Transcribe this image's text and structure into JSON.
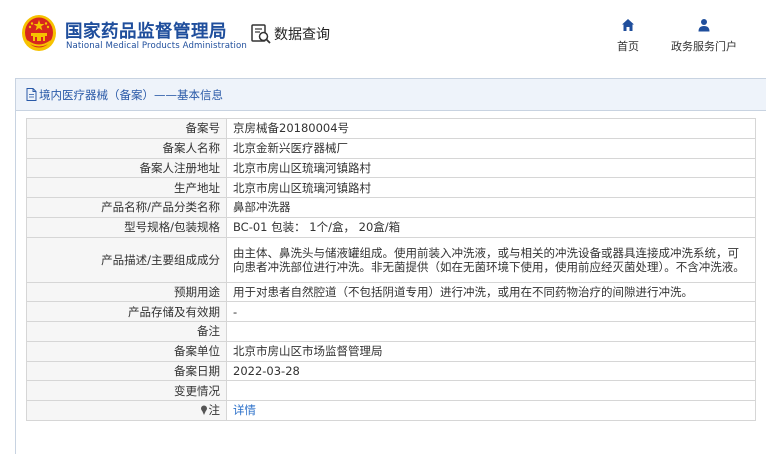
{
  "header": {
    "org_name_cn": "国家药品监督管理局",
    "org_name_en": "National Medical Products Administration",
    "query_label": "数据查询",
    "nav": [
      {
        "label": "首页",
        "icon": "home-icon"
      },
      {
        "label": "政务服务门户",
        "icon": "user-icon"
      }
    ]
  },
  "panel": {
    "title": "境内医疗器械（备案）——基本信息"
  },
  "rows": [
    {
      "label": "备案号",
      "value": "京房械备20180004号"
    },
    {
      "label": "备案人名称",
      "value": "北京金新兴医疗器械厂"
    },
    {
      "label": "备案人注册地址",
      "value": "北京市房山区琉璃河镇路村"
    },
    {
      "label": "生产地址",
      "value": "北京市房山区琉璃河镇路村"
    },
    {
      "label": "产品名称/产品分类名称",
      "value": "鼻部冲洗器"
    },
    {
      "label": "型号规格/包装规格",
      "value": "BC-01 包装： 1个/盒， 20盒/箱"
    },
    {
      "label": "产品描述/主要组成成分",
      "value": "由主体、鼻洗头与储液罐组成。使用前装入冲洗液，或与相关的冲洗设备或器具连接成冲洗系统，可向患者冲洗部位进行冲洗。非无菌提供（如在无菌环境下使用，使用前应经灭菌处理）。不含冲洗液。"
    },
    {
      "label": "预期用途",
      "value": "用于对患者自然腔道（不包括阴道专用）进行冲洗，或用在不同药物治疗的间隙进行冲洗。"
    },
    {
      "label": "产品存储及有效期",
      "value": "-"
    },
    {
      "label": "备注",
      "value": ""
    },
    {
      "label": "备案单位",
      "value": "北京市房山区市场监督管理局"
    },
    {
      "label": "备案日期",
      "value": "2022-03-28"
    },
    {
      "label": "变更情况",
      "value": ""
    }
  ],
  "note_row": {
    "label": "注",
    "link_text": "详情"
  },
  "colors": {
    "brand_blue": "#1f4e9c",
    "link_blue": "#2a6fc9",
    "emblem_red": "#d7261e",
    "emblem_gold": "#f6c200"
  }
}
